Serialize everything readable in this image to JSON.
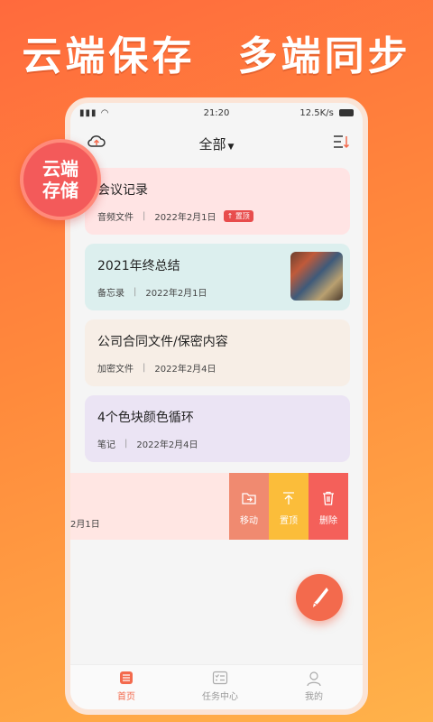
{
  "banner": {
    "left_text": "云端保存",
    "right_text": "多端同步"
  },
  "badge": {
    "line1": "云端",
    "line2": "存储"
  },
  "status_bar": {
    "time": "21:20",
    "speed": "12.5K/s"
  },
  "appbar": {
    "title": "全部"
  },
  "notes": [
    {
      "title": "会议记录",
      "type": "音频文件",
      "date": "2022年2月1日",
      "pin": "置顶",
      "color": "#ffe4e4"
    },
    {
      "title": "2021年终总结",
      "type": "备忘录",
      "date": "2022年2月1日",
      "color": "#dcefee"
    },
    {
      "title": "公司合同文件/保密内容",
      "type": "加密文件",
      "date": "2022年2月4日",
      "color": "#f7eee6"
    },
    {
      "title": "4个色块颜色循环",
      "type": "笔记",
      "date": "2022年2月4日",
      "color": "#ebe4f4"
    }
  ],
  "swipe_row": {
    "date_fragment": "2月1日",
    "actions": [
      {
        "label": "移动",
        "icon": "folder-move-icon",
        "color": "#f08a70"
      },
      {
        "label": "置顶",
        "icon": "pin-top-icon",
        "color": "#fbbd3a"
      },
      {
        "label": "删除",
        "icon": "trash-icon",
        "color": "#f4605a"
      }
    ]
  },
  "tabs": [
    {
      "label": "首页",
      "icon": "home-icon",
      "active": true
    },
    {
      "label": "任务中心",
      "icon": "task-icon",
      "active": false
    },
    {
      "label": "我的",
      "icon": "user-icon",
      "active": false
    }
  ],
  "colors": {
    "accent": "#f36a4d"
  }
}
